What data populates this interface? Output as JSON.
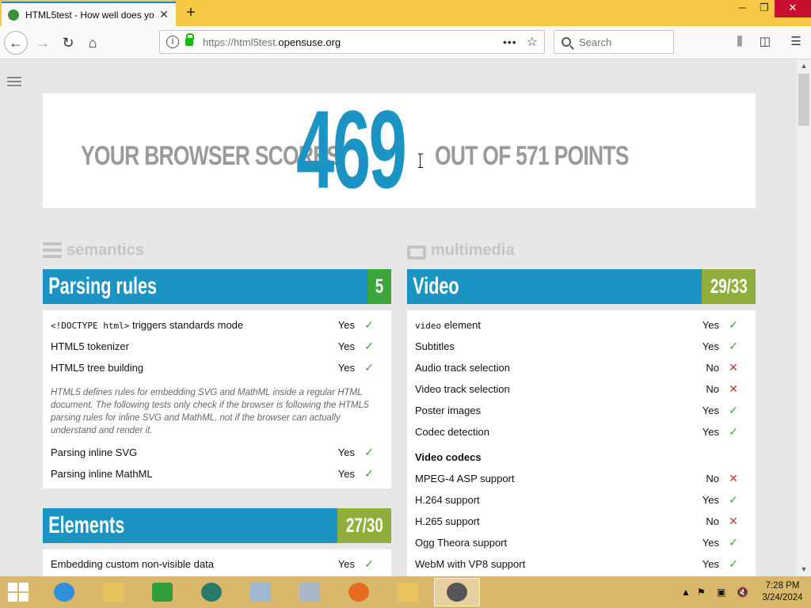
{
  "browser": {
    "tab_title": "HTML5test - How well does yo",
    "new_tab": "+",
    "window_min": "─",
    "window_max": "❐",
    "window_close": "✕",
    "url_prefix": "https://html5test.",
    "url_host": "opensuse.org",
    "url_more": "•••",
    "search_placeholder": "Search"
  },
  "score": {
    "prefix": "YOUR BROWSER SCORES",
    "value": "469",
    "suffix": "OUT OF 571 POINTS"
  },
  "sections": {
    "semantics": "semantics",
    "multimedia": "multimedia"
  },
  "parsing": {
    "title": "Parsing rules",
    "score": "5",
    "rows": [
      {
        "code": "<!DOCTYPE html>",
        "label": " triggers standards mode",
        "result": "Yes",
        "pass": true
      },
      {
        "label": "HTML5 tokenizer",
        "result": "Yes",
        "pass": true
      },
      {
        "label": "HTML5 tree building",
        "result": "Yes",
        "pass": true
      }
    ],
    "note": "HTML5 defines rules for embedding SVG and MathML inside a regular HTML document. The following tests only check if the browser is following the HTML5 parsing rules for inline SVG and MathML, not if the browser can actually understand and render it.",
    "rows2": [
      {
        "label": "Parsing inline SVG",
        "result": "Yes",
        "pass": true
      },
      {
        "label": "Parsing inline MathML",
        "result": "Yes",
        "pass": true
      }
    ]
  },
  "elements": {
    "title": "Elements",
    "score": "27/30",
    "rows": [
      {
        "label": "Embedding custom non-visible data",
        "result": "Yes",
        "pass": true
      }
    ]
  },
  "video": {
    "title": "Video",
    "score": "29/33",
    "rows": [
      {
        "code": "video",
        "label": " element",
        "result": "Yes",
        "pass": true
      },
      {
        "label": "Subtitles",
        "result": "Yes",
        "pass": true
      },
      {
        "label": "Audio track selection",
        "result": "No",
        "pass": false
      },
      {
        "label": "Video track selection",
        "result": "No",
        "pass": false
      },
      {
        "label": "Poster images",
        "result": "Yes",
        "pass": true
      },
      {
        "label": "Codec detection",
        "result": "Yes",
        "pass": true
      }
    ],
    "codecs_heading": "Video codecs",
    "codecs": [
      {
        "label": "MPEG-4 ASP support",
        "result": "No",
        "pass": false
      },
      {
        "label": "H.264 support",
        "result": "Yes",
        "pass": true
      },
      {
        "label": "H.265 support",
        "result": "No",
        "pass": false
      },
      {
        "label": "Ogg Theora support",
        "result": "Yes",
        "pass": true
      },
      {
        "label": "WebM with VP8 support",
        "result": "Yes",
        "pass": true
      }
    ]
  },
  "taskbar": {
    "time": "7:28 PM",
    "date": "3/24/2024"
  },
  "colors": {
    "accent_blue": "#1b93c3",
    "pass_green": "#3ba63b",
    "score_olive": "#8fae3c",
    "fail_red": "#c0392b"
  }
}
